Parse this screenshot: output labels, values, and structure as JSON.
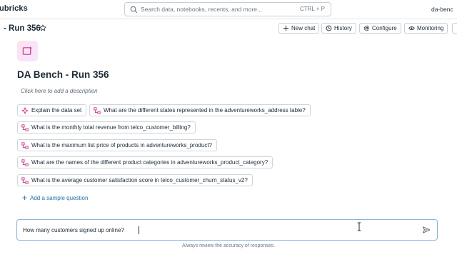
{
  "app": {
    "brand": "ubricks",
    "workspace": "da-benc"
  },
  "search": {
    "placeholder": "Search data, notebooks, recents, and more...",
    "shortcut": "CTRL + P"
  },
  "header": {
    "title": "- Run 356",
    "buttons": {
      "new_chat": "New chat",
      "history": "History",
      "configure": "Configure",
      "monitoring": "Monitoring"
    }
  },
  "space": {
    "title": "DA Bench - Run 356",
    "description_placeholder": "Click here to add a description"
  },
  "sample_questions": [
    "Explain the data set",
    "What are the different states represented in the adventureworks_address table?",
    "What is the monthly total revenue from telco_customer_billing?",
    "What is the maximum list price of products in adventureworks_product?",
    "What are the names of the different product categories in adventureworks_product_category?",
    "What is the average customer satisfaction score in telco_customer_churn_status_v2?"
  ],
  "add_question_label": "Add a sample question",
  "chat": {
    "input_value": "How many customers signed up online?",
    "footer_note": "Always review the accuracy of responses."
  },
  "colors": {
    "accent": "#2272b4",
    "input_border": "#8ab4e0",
    "icon_pink": "#d6318a"
  }
}
